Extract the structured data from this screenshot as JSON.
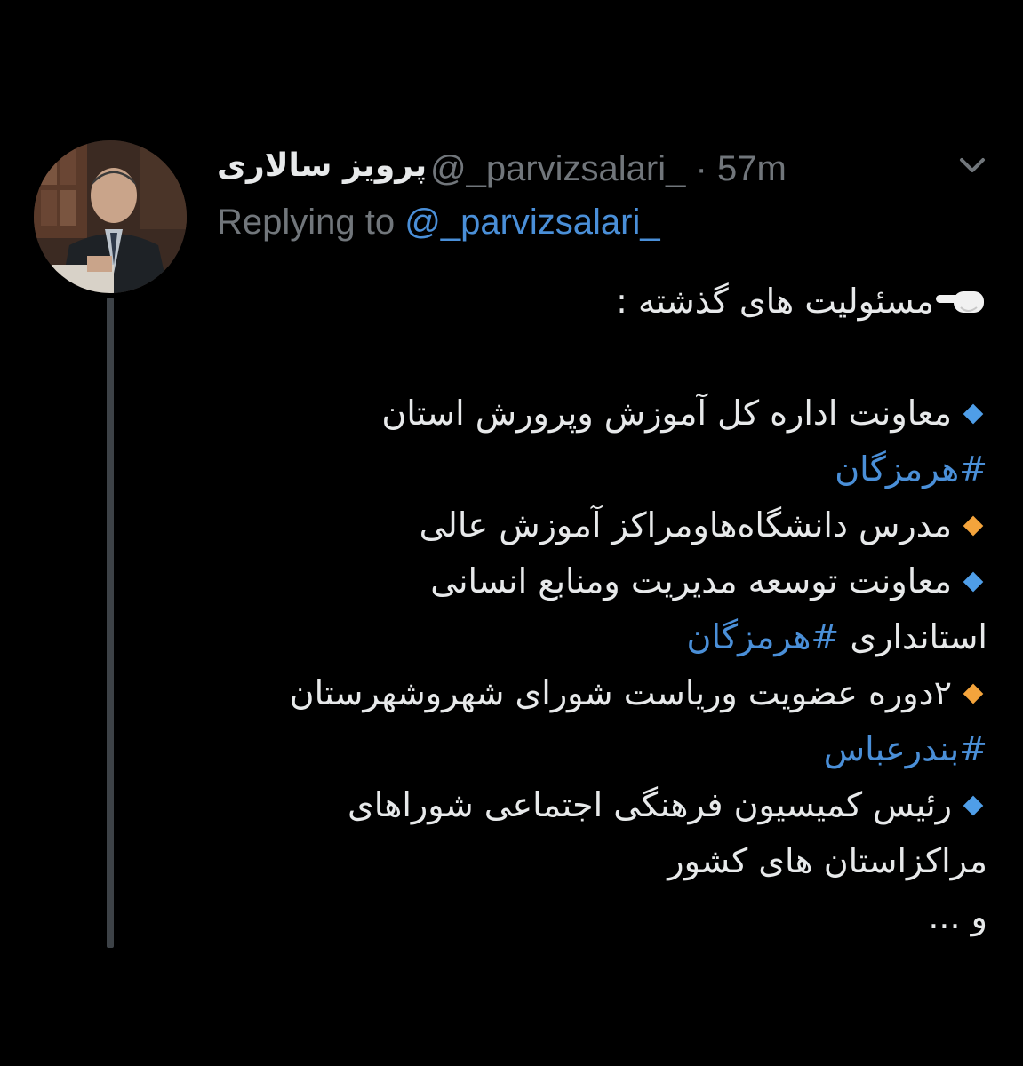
{
  "tweet": {
    "author": {
      "display_name": "پرویز سالاری",
      "handle": "@_parvizsalari_",
      "separator": "·",
      "time": "57m"
    },
    "replying_to": {
      "prefix": "Replying to",
      "mention": "@_parvizsalari_"
    },
    "lines": {
      "heading": "مسئولیت های گذشته :",
      "item1_text": "معاونت اداره کل آموزش وپرورش استان",
      "item1_hashtag": "#هرمزگان",
      "item2_text": "مدرس دانشگاه‌هاومراکز آموزش عالی",
      "item3_text": "معاونت توسعه مدیریت ومنابع انسانی",
      "item3_cont": "استانداری",
      "item3_hashtag": "#هرمزگان",
      "item4_text": "۲دوره عضویت وریاست شورای شهروشهرستان",
      "item4_hashtag": "#بندرعباس",
      "item5_text": "رئیس کمیسیون فرهنگی اجتماعی شوراهای",
      "item5_cont": "مراکزاستان های کشور",
      "ending": "و ..."
    }
  },
  "icons": {
    "pointing": "backhand-index-pointing-left-icon",
    "bullet_blue": "small-blue-diamond-icon",
    "bullet_orange": "small-orange-diamond-icon",
    "menu": "chevron-down-icon"
  },
  "colors": {
    "background": "#000000",
    "text": "#e7e9ea",
    "secondary": "#71767b",
    "link": "#4a8fd8",
    "diamond_blue": "#4f9ee8",
    "diamond_orange": "#f4a43c"
  }
}
